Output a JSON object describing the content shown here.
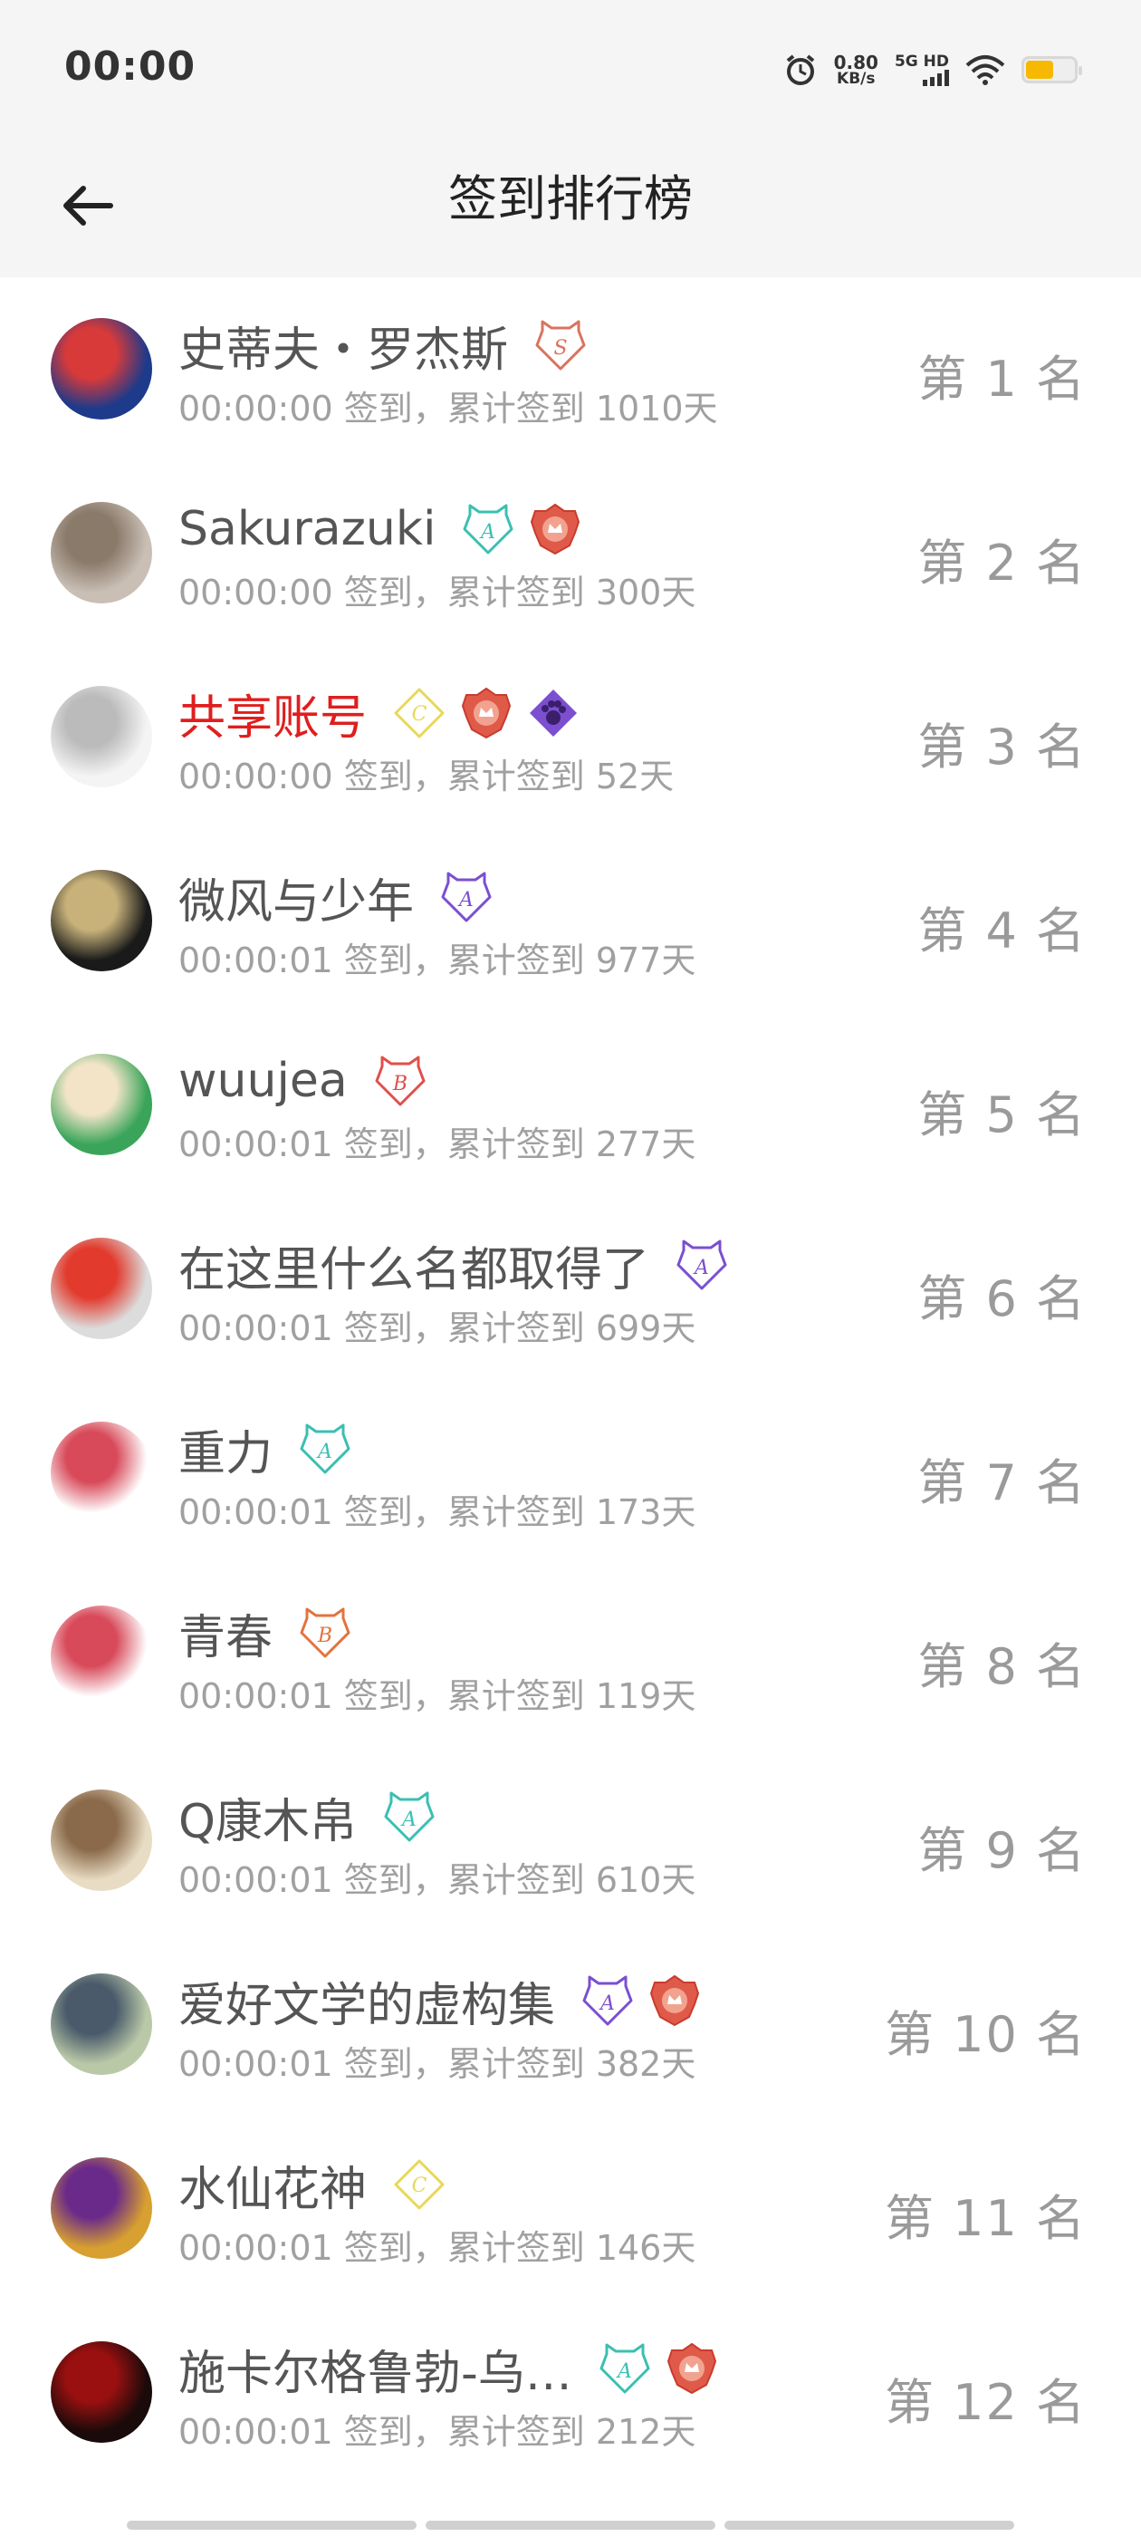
{
  "status_bar": {
    "time": "00:00",
    "speed_value": "0.80",
    "speed_unit": "KB/s",
    "network": "5G HD"
  },
  "header": {
    "title": "签到排行榜"
  },
  "rows": [
    {
      "name": "史蒂夫・罗杰斯",
      "sub": "00:00:00 签到，累计签到 1010天",
      "rank": "第 1 名",
      "badges": [
        "S"
      ],
      "avatar": [
        "#1e3a8a",
        "#d83a3a"
      ]
    },
    {
      "name": "Sakurazuki",
      "sub": "00:00:00 签到，累计签到 300天",
      "rank": "第 2 名",
      "badges": [
        "A-teal",
        "crown"
      ],
      "avatar": [
        "#c9bfb5",
        "#8a7a6a"
      ]
    },
    {
      "name": "共享账号",
      "sub": "00:00:00 签到，累计签到 52天",
      "rank": "第 3 名",
      "badges": [
        "C",
        "crown",
        "paw"
      ],
      "avatar": [
        "#f4f4f4",
        "#bbbbbb"
      ],
      "name_color": "#e01e1e"
    },
    {
      "name": "微风与少年",
      "sub": "00:00:01 签到，累计签到 977天",
      "rank": "第 4 名",
      "badges": [
        "A-purple"
      ],
      "avatar": [
        "#1a1a1a",
        "#c8b27a"
      ]
    },
    {
      "name": "wuujea",
      "sub": "00:00:01 签到，累计签到 277天",
      "rank": "第 5 名",
      "badges": [
        "B-red"
      ],
      "avatar": [
        "#3aa55a",
        "#f3e4c8"
      ]
    },
    {
      "name": "在这里什么名都取得了",
      "sub": "00:00:01 签到，累计签到 699天",
      "rank": "第 6 名",
      "badges": [
        "A-purple"
      ],
      "avatar": [
        "#dcdcdc",
        "#e23b2e"
      ]
    },
    {
      "name": "重力",
      "sub": "00:00:01 签到，累计签到 173天",
      "rank": "第 7 名",
      "badges": [
        "A-teal"
      ],
      "avatar": [
        "#ffffff",
        "#d84a5a"
      ]
    },
    {
      "name": "青春",
      "sub": "00:00:01 签到，累计签到 119天",
      "rank": "第 8 名",
      "badges": [
        "B-orange"
      ],
      "avatar": [
        "#ffffff",
        "#d84a5a"
      ]
    },
    {
      "name": "Q康木帛",
      "sub": "00:00:01 签到，累计签到 610天",
      "rank": "第 9 名",
      "badges": [
        "A-teal"
      ],
      "avatar": [
        "#e8dcc4",
        "#8a6a4a"
      ]
    },
    {
      "name": "爱好文学的虚构集",
      "sub": "00:00:01 签到，累计签到 382天",
      "rank": "第 10 名",
      "badges": [
        "A-purple",
        "crown"
      ],
      "avatar": [
        "#b9c9a8",
        "#4a5a6a"
      ]
    },
    {
      "name": "水仙花神",
      "sub": "00:00:01 签到，累计签到 146天",
      "rank": "第 11 名",
      "badges": [
        "C"
      ],
      "avatar": [
        "#d8a030",
        "#6a2a8a"
      ]
    },
    {
      "name": "施卡尔格鲁勃-乌…",
      "sub": "00:00:01 签到，累计签到 212天",
      "rank": "第 12 名",
      "badges": [
        "A-teal",
        "crown"
      ],
      "avatar": [
        "#1a0a0a",
        "#9a1010"
      ]
    }
  ],
  "colors": {
    "teal": "#3bbfb2",
    "purple": "#7b4fd0",
    "red": "#e0504a",
    "orange": "#e3733e",
    "yellow": "#e8d85a",
    "pink": "#d9735f",
    "crown": "#e05a4a"
  }
}
